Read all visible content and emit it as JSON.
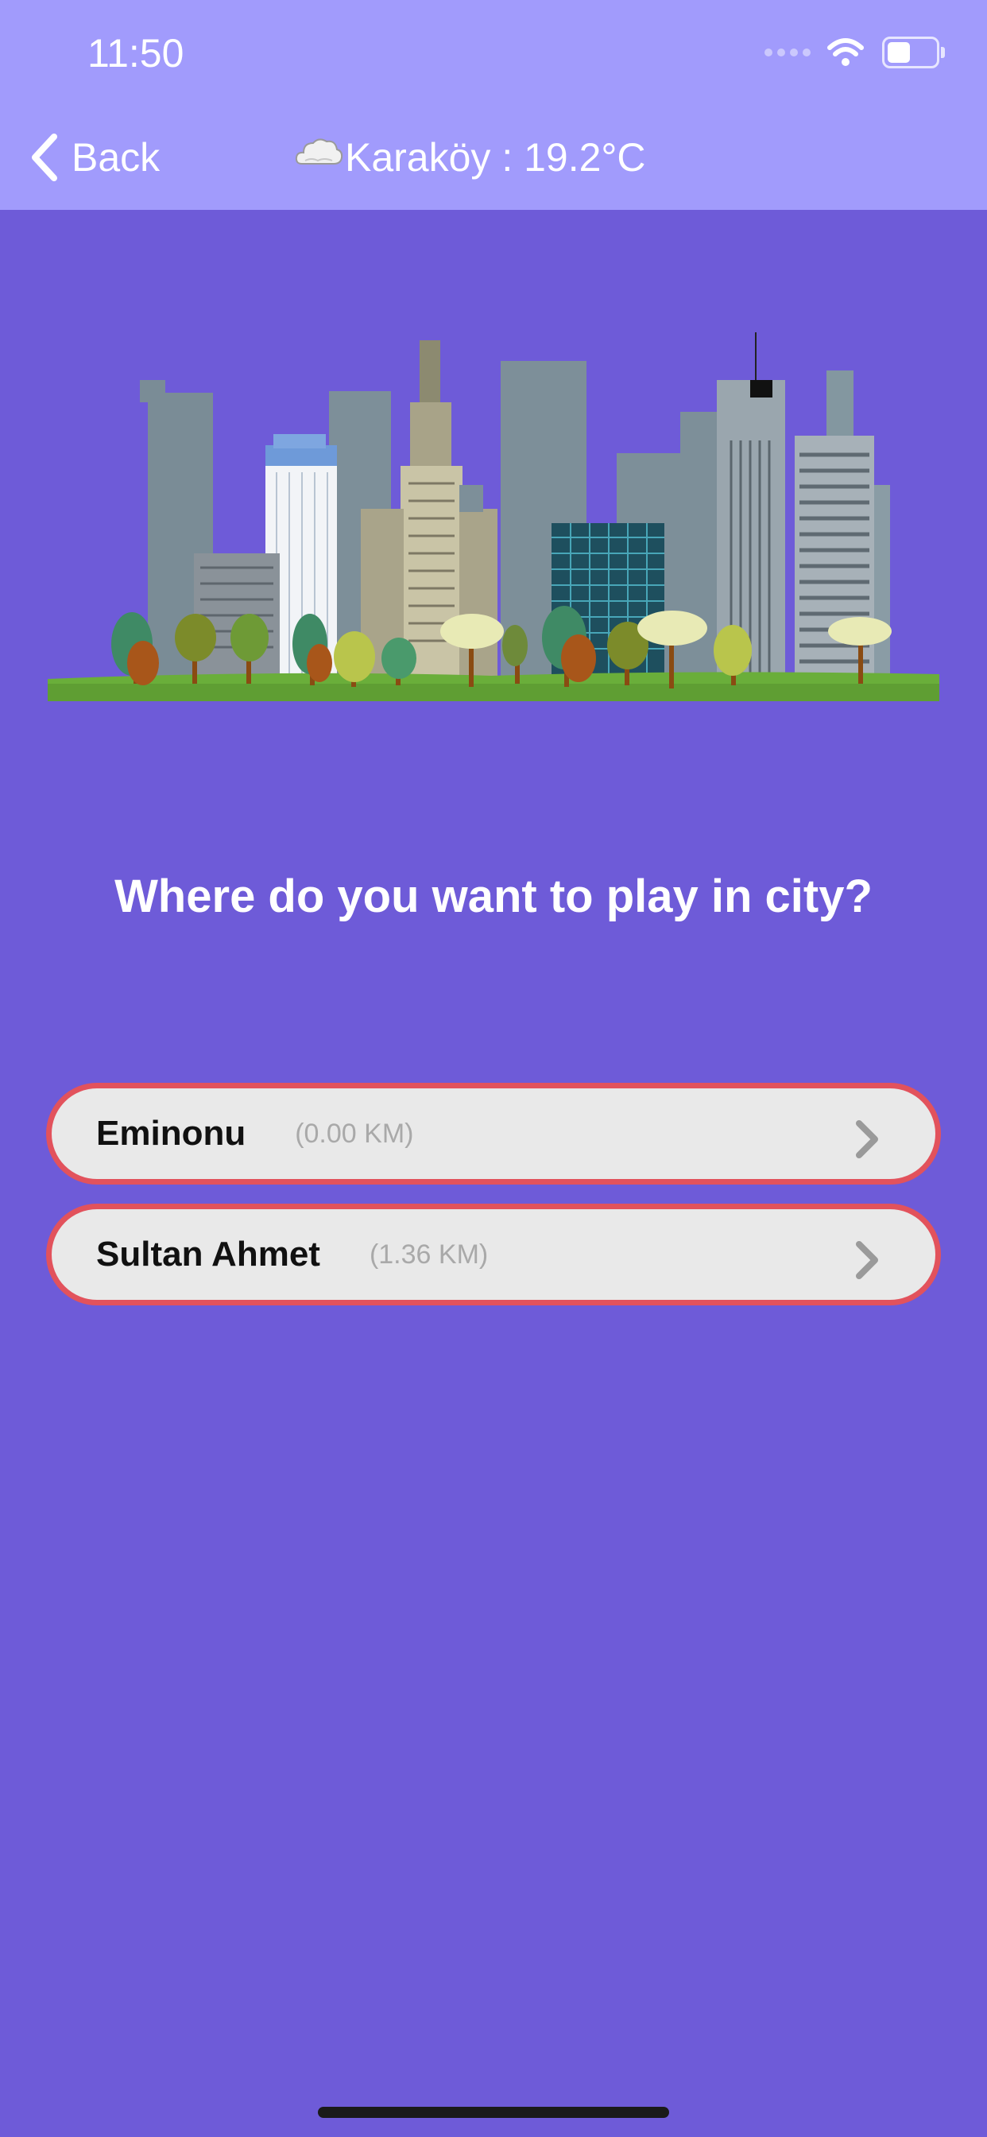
{
  "status_bar": {
    "time": "11:50"
  },
  "nav": {
    "back_label": "Back",
    "title": "Karaköy : 19.2°C",
    "weather_icon": "cloud-icon"
  },
  "main": {
    "question": "Where do you want to play in city?",
    "locations": [
      {
        "name": "Eminonu",
        "distance": "(0.00 KM)"
      },
      {
        "name": "Sultan Ahmet",
        "distance": "(1.36 KM)"
      }
    ]
  },
  "colors": {
    "header_bg": "#a19bfc",
    "page_bg": "#6e5bd8",
    "item_border": "#e2525c",
    "item_bg": "#e9e9e9"
  }
}
